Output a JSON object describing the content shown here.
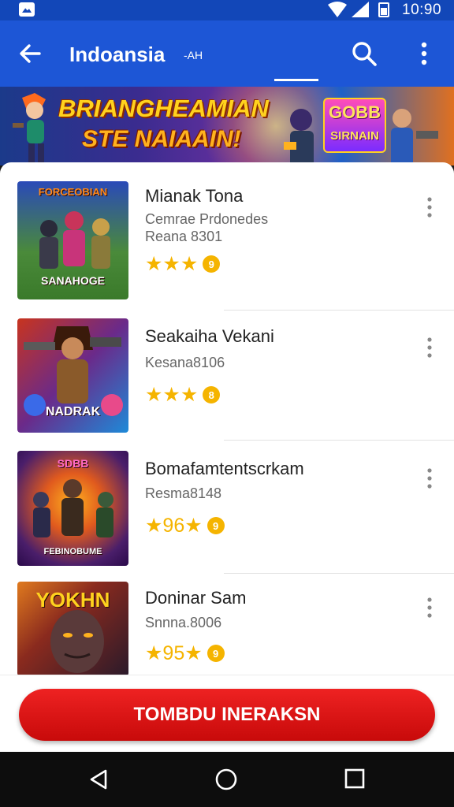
{
  "status_bar": {
    "time": "10:90",
    "icons": [
      "image-icon",
      "wifi-icon",
      "signal-icon",
      "battery-icon"
    ]
  },
  "app_bar": {
    "title": "Indoansia",
    "subtitle": "-AH",
    "icons": [
      "back-arrow-icon",
      "search-icon",
      "more-vert-icon"
    ]
  },
  "banner": {
    "title": "BRIANGHEAMIAN",
    "subtitle": "STE NAIAAIN!",
    "logo_top": "GOBB",
    "logo_bottom": "SIRNAIN"
  },
  "items": [
    {
      "title": "Mianak Tona",
      "line1": "Cemrae Prdonedes",
      "line2": "Reana 8301",
      "thumb_top": "FORCEOBIAN",
      "thumb_bottom": "SANAHOGE",
      "stars": "★★★",
      "rating": "9"
    },
    {
      "title": "Seakaiha Vekani",
      "line1": "Kesana8106",
      "thumb_bottom": "NADRAK",
      "stars": "★★★",
      "rating": "8"
    },
    {
      "title": "Bomafamtentscrkam",
      "line1": "Resma8148",
      "thumb_top": "SDBB",
      "thumb_bottom": "FEBINOBUME",
      "stars": "★96★",
      "rating": "9"
    },
    {
      "title": "Doninar Sam",
      "line1": "Snnna.8006",
      "thumb_top": "YOKHN",
      "stars": "★95★",
      "rating": "9"
    }
  ],
  "main_button": {
    "label": "TOMBDU INERAKSN"
  },
  "nav_bar": {
    "icons": [
      "nav-back-icon",
      "nav-home-icon",
      "nav-recent-icon"
    ]
  },
  "colors": {
    "app_bar": "#1d56d6",
    "status_bar": "#1247b8",
    "star": "#f5b400",
    "button": "#e01414",
    "nav_bar": "#0d0d0d"
  }
}
